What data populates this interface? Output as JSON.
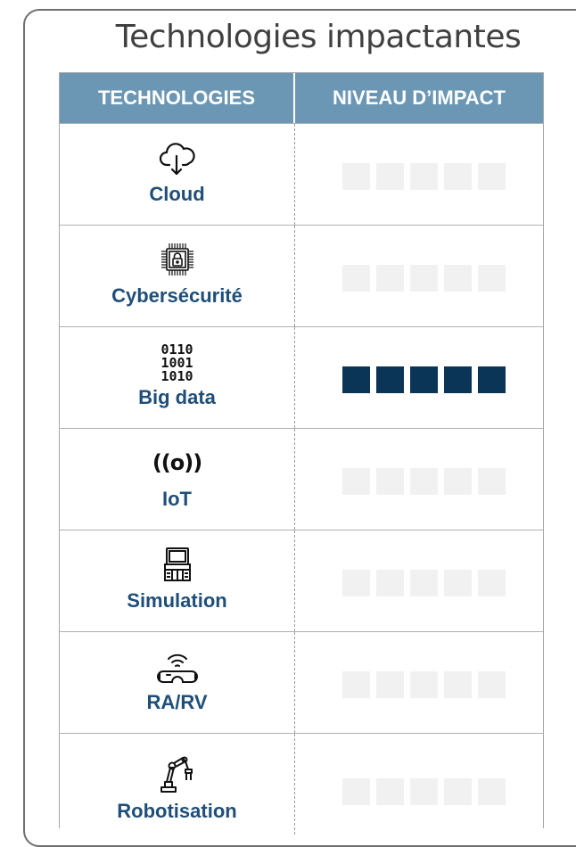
{
  "title": "Technologies impactantes",
  "headers": {
    "technologies": "TECHNOLOGIES",
    "impact": "NIVEAU D’IMPACT"
  },
  "rows": [
    {
      "label": "Cloud",
      "icon": "cloud-download-icon",
      "impact_level": 0,
      "impact_max": 5
    },
    {
      "label": "Cybersécurité",
      "icon": "chip-lock-icon",
      "impact_level": 0,
      "impact_max": 5
    },
    {
      "label": "Big data",
      "icon": "binary-data-icon",
      "impact_level": 5,
      "impact_max": 5,
      "binary_lines": [
        "0110",
        "1001",
        "1010"
      ]
    },
    {
      "label": "IoT",
      "icon": "broadcast-icon",
      "impact_level": 0,
      "impact_max": 5,
      "icon_glyph": "((o))"
    },
    {
      "label": "Simulation",
      "icon": "computer-terminal-icon",
      "impact_level": 0,
      "impact_max": 5
    },
    {
      "label": "RA/RV",
      "icon": "vr-headset-icon",
      "impact_level": 0,
      "impact_max": 5
    },
    {
      "label": "Robotisation",
      "icon": "robot-arm-icon",
      "impact_level": 0,
      "impact_max": 5
    }
  ],
  "colors": {
    "header_bg": "#6c97b4",
    "label": "#1f4e79",
    "block_on": "#0b3557",
    "block_off": "#f1f1f1"
  }
}
